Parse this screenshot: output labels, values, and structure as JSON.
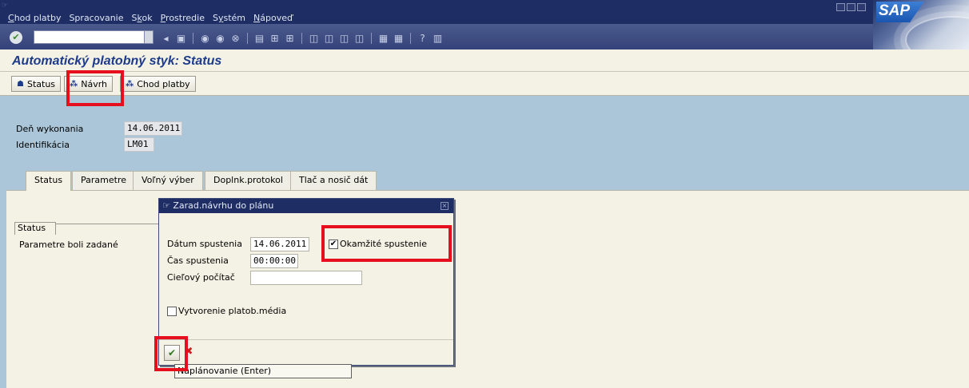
{
  "menu": {
    "items": [
      {
        "label": "Chod platby",
        "u": "C"
      },
      {
        "label": "Spracovanie",
        "u": ""
      },
      {
        "label": "Skok",
        "u": "k"
      },
      {
        "label": "Prostredie",
        "u": "P"
      },
      {
        "label": "Systém",
        "u": "y"
      },
      {
        "label": "Nápoveď",
        "u": "N"
      }
    ]
  },
  "logo": {
    "text": "SAP"
  },
  "toolbar": {
    "command_field_value": "",
    "icons": [
      "enter-icon",
      "back-icon",
      "save-icon",
      "back-nav-icon",
      "exit-icon",
      "cancel-icon",
      "print-icon",
      "find-icon",
      "find-next-icon",
      "first-page-icon",
      "prev-page-icon",
      "next-page-icon",
      "last-page-icon",
      "new-session-icon",
      "shortcut-icon",
      "help-icon",
      "layout-icon"
    ]
  },
  "title": "Automatický platobný styk: Status",
  "app_toolbar": {
    "status": "Status",
    "navrh": "Návrh",
    "chod_platby": "Chod platby"
  },
  "header": {
    "den_label": "Deň wykonania",
    "den_value": "14.06.2011",
    "id_label": "Identifikácia",
    "id_value": "LM01"
  },
  "tabs": [
    "Status",
    "Parametre",
    "Voľný výber",
    "Doplnk.protokol",
    "Tlač a nosič dát"
  ],
  "status_panel": {
    "tab_label": "Status",
    "message": "Parametre boli zadané"
  },
  "dialog": {
    "title": "Zarad.návrhu do plánu",
    "datum_label": "Dátum spustenia",
    "datum_value": "14.06.2011",
    "cas_label": "Čas spustenia",
    "cas_value": "00:00:00",
    "ciel_label": "Cieľový počítač",
    "ciel_value": "",
    "okamzite_label": "Okamžité spustenie",
    "okamzite_checked": true,
    "vytvorenie_label": "Vytvorenie platob.média",
    "vytvorenie_checked": false
  },
  "tooltip": "Naplánovanie  (Enter)"
}
